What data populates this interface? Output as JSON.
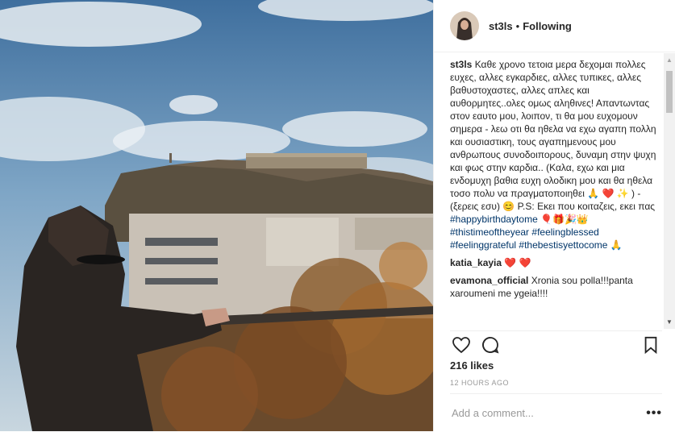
{
  "post": {
    "username": "st3ls",
    "separator": "•",
    "follow_status": "Following"
  },
  "caption": {
    "username": "st3ls",
    "text": "Καθε χρονο τετοια μερα δεχομαι πολλες ευχες, αλλες εγκαρδιες, αλλες τυπικες, αλλες βαθυστοχαστες, αλλες απλες και αυθορμητες..ολες ομως αληθινες! Απαντωντας στον εαυτο μου, λοιπον, τι θα μου ευχομουν σημερα - λεω οτι θα ηθελα να εχω αγαπη πολλη και ουσιαστικη, τους αγαπημενους μου ανθρωπους συνοδοιπορους, δυναμη στην ψυχη και φως στην καρδια.. (Καλα, εχω και μια ενδομυχη βαθια ευχη ολοδικη μου και θα ηθελα τοσο πολυ να πραγματοποιηθει 🙏 ❤️ ✨ ) - (ξερεις εσυ) 😊 P.S: Εκει που κοιταζεις, εκει πας",
    "hashtags": [
      "#happybirthdaytome",
      "🎈🎁🎉👑",
      "#thistimeoftheyear",
      "#feelingblessed",
      "#feelinggrateful",
      "#thebestisyettocome",
      "🙏"
    ]
  },
  "comments": [
    {
      "user": "katia_kayia",
      "text": "❤️ ❤️"
    },
    {
      "user": "evamona_official",
      "text": "Xronia sou polla!!!panta xaroumeni me ygeia!!!!"
    }
  ],
  "likes": "216 likes",
  "time": "12 HOURS AGO",
  "add_comment": {
    "placeholder": "Add a comment..."
  },
  "more": "•••",
  "scroll": {
    "up": "▲",
    "down": "▼"
  }
}
